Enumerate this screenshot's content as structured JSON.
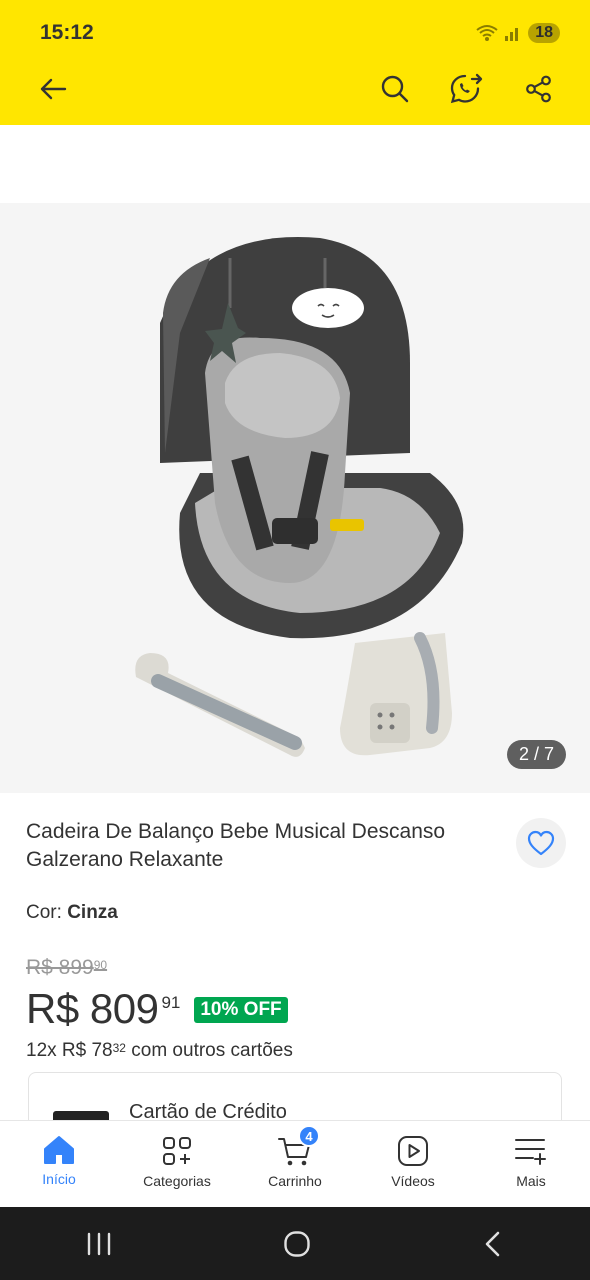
{
  "status_bar": {
    "time": "15:12",
    "battery": "18"
  },
  "header": {
    "back_icon": "arrow-left-icon",
    "search_icon": "search-icon",
    "whatsapp_icon": "whatsapp-share-icon",
    "share_icon": "share-icon"
  },
  "gallery": {
    "counter": "2 / 7",
    "current_index": 2,
    "total": 7
  },
  "product": {
    "title": "Cadeira De Balanço Bebe Musical Descanso Galzerano Relaxante",
    "color_label": "Cor: ",
    "color_value": "Cinza",
    "old_price": "R$ 899",
    "old_price_cents": "90",
    "price": "R$ 809",
    "price_cents": "91",
    "discount": "10% OFF",
    "installments_prefix": "12x R$ 78",
    "installments_cents": "32",
    "installments_suffix": " com outros cartões"
  },
  "payment": {
    "card_title": "Cartão de Crédito"
  },
  "tabbar": {
    "items": [
      {
        "label": "Início",
        "icon": "home-icon",
        "active": true
      },
      {
        "label": "Categorias",
        "icon": "categories-icon",
        "active": false
      },
      {
        "label": "Carrinho",
        "icon": "cart-icon",
        "active": false,
        "badge": "4"
      },
      {
        "label": "Vídeos",
        "icon": "video-icon",
        "active": false
      },
      {
        "label": "Mais",
        "icon": "menu-more-icon",
        "active": false
      }
    ]
  },
  "colors": {
    "brand_yellow": "#FFE600",
    "accent_blue": "#3483fa",
    "discount_green": "#00a650"
  }
}
